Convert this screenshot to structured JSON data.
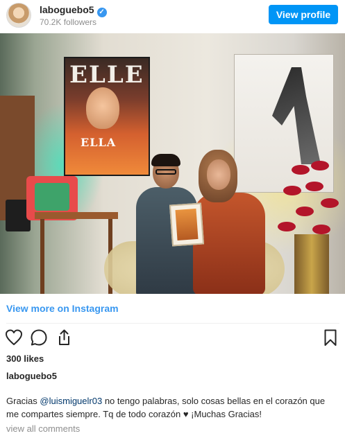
{
  "header": {
    "username": "laboguebo5",
    "followers": "70.2K followers",
    "view_profile_label": "View profile"
  },
  "photo": {
    "magazine_masthead": "ELLE",
    "magazine_headline": "ELLA"
  },
  "links": {
    "view_more": "View more on Instagram",
    "view_all_comments": "view all comments"
  },
  "post": {
    "likes": "300 likes",
    "owner_username": "laboguebo5",
    "caption_prefix": "Gracias ",
    "caption_mention": "@luismiguelr03",
    "caption_suffix": " no tengo palabras, solo cosas bellas en el corazón que me compartes siempre. Tq de todo corazón ♥ ¡Muchas Gracias!"
  },
  "icons": [
    "verified-badge-icon",
    "heart-icon",
    "comment-icon",
    "share-icon",
    "bookmark-icon"
  ],
  "colors": {
    "accent": "#0095f6",
    "link": "#3897f0",
    "mention": "#00376b",
    "muted": "#8e8e8e",
    "text": "#262626"
  }
}
